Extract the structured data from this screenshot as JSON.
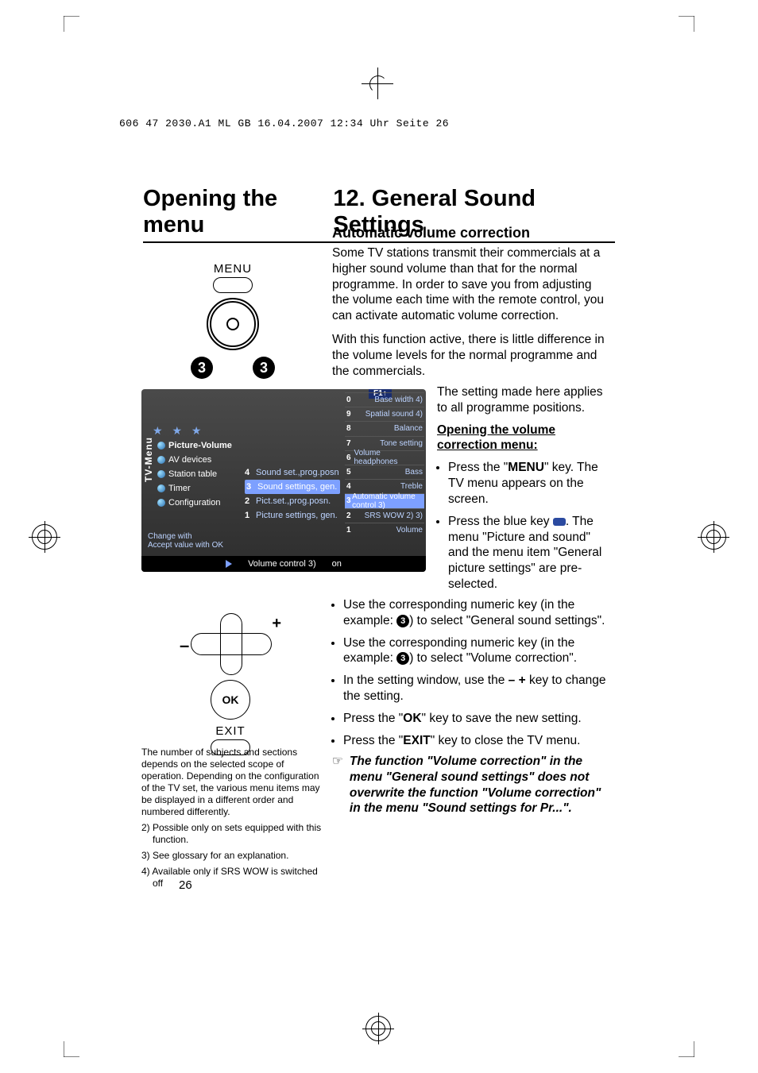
{
  "file_header": "606 47 2030.A1  ML GB  16.04.2007  12:34 Uhr  Seite 26",
  "title_left": "Opening the menu",
  "title_right": "12. General Sound Settings",
  "subtitle": "Automatic volume correction",
  "intro_p1": "Some TV stations transmit their commercials at a higher sound volume than that for the normal programme. In order to save you from adjusting the volume each time with the remote control, you can activate automatic volume correction.",
  "intro_p2": "With this function active, there is little difference in the volume levels for the normal programme and the commercials.",
  "right_side": {
    "applies": "The setting made here applies to all programme positions.",
    "open_heading": "Opening the volume correction menu:",
    "b1a": "Press the \"",
    "b1b": "MENU",
    "b1c": "\" key. The TV menu appears on the screen.",
    "b2a": "Press the blue key ",
    "b2b": ". The menu \"Picture and sound\" and the menu item \"General picture settings\" are pre-selected."
  },
  "lower": {
    "l1a": "Use the corresponding numeric key (in the example: ",
    "l1b": ") to select \"General sound settings\".",
    "l2a": "Use the corresponding numeric key (in the example: ",
    "l2b": ") to select \"Volume correction\".",
    "l3a": "In the setting window, use the ",
    "l3b": " key to change the setting.",
    "minus_plus": "– +",
    "l4a": "Press the \"",
    "l4b": "OK",
    "l4c": "\" key to save the new setting.",
    "l5a": "Press the \"",
    "l5b": "EXIT",
    "l5c": "\" key to close the TV menu."
  },
  "badge_three": "3",
  "note_icon": "☞",
  "note_text": "The function \"Volume correction\" in the menu \"General sound settings\" does not overwrite the function \"Volume correction\" in the menu \"Sound settings for Pr...\".",
  "remote": {
    "menu": "MENU",
    "three": "3",
    "ok": "OK",
    "exit": "EXIT",
    "plus": "+",
    "minus": "–"
  },
  "osd": {
    "stars": "★ ★ ★",
    "tv_menu": "TV-Menu",
    "main": [
      "Picture-Volume",
      "AV devices",
      "Station table",
      "Timer",
      "Configuration"
    ],
    "hint1": "Change with",
    "hint2": "Accept value with OK",
    "sub1": [
      {
        "idx": "4",
        "label": "Sound set.,prog.posn"
      },
      {
        "idx": "3",
        "label": "Sound settings, gen."
      },
      {
        "idx": "2",
        "label": "Pict.set.,prog.posn."
      },
      {
        "idx": "1",
        "label": "Picture settings, gen."
      }
    ],
    "f1": "F1↑",
    "sub2": [
      {
        "idx": "0",
        "label": "Base width 4)"
      },
      {
        "idx": "9",
        "label": "Spatial sound 4)"
      },
      {
        "idx": "8",
        "label": "Balance"
      },
      {
        "idx": "7",
        "label": "Tone setting"
      },
      {
        "idx": "6",
        "label": "Volume headphones"
      },
      {
        "idx": "5",
        "label": "Bass"
      },
      {
        "idx": "4",
        "label": "Treble"
      },
      {
        "idx": "3",
        "label": "Automatic volume control 3)"
      },
      {
        "idx": "2",
        "label": "SRS WOW 2) 3)"
      },
      {
        "idx": "1",
        "label": "Volume"
      }
    ],
    "footer_label": "Volume control 3)",
    "footer_value": "on"
  },
  "footnotes": {
    "intro": "The number of subjects and sections depends on the selected scope of operation. Depending on the configuration of the TV set, the various menu items may be displayed in a different order and numbered differently.",
    "f2": "2) Possible only on sets equipped with this function.",
    "f3": "3) See glossary for an explanation.",
    "f4": "4) Available only if SRS WOW is switched off"
  },
  "page_number": "26"
}
